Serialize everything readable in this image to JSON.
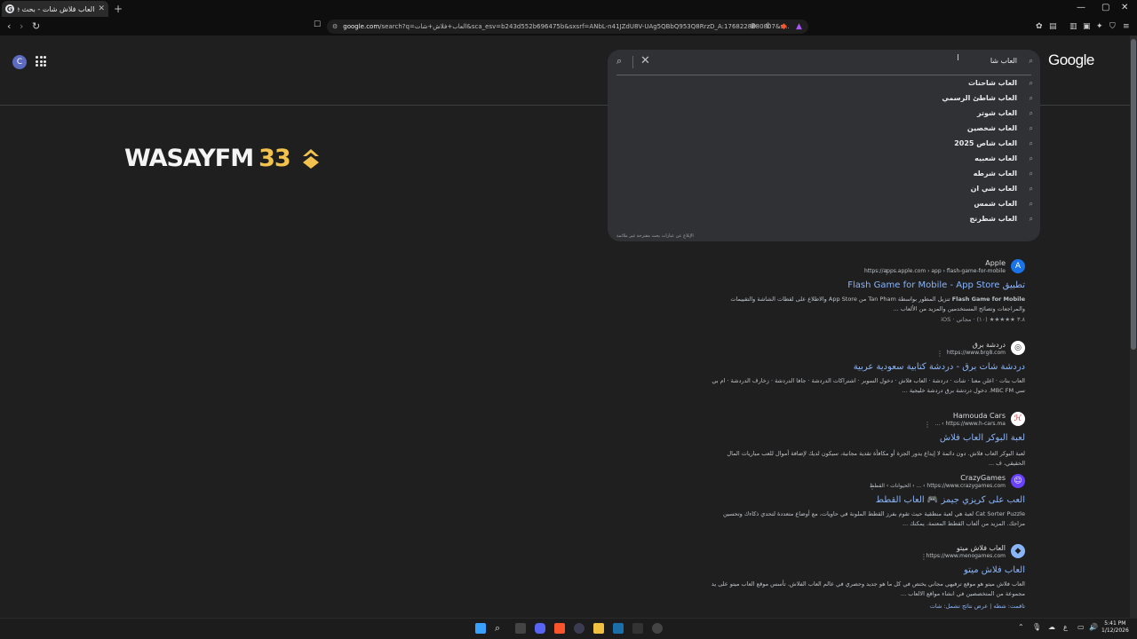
{
  "browser": {
    "tab_title": "العاب فلاش شات - بحث Google",
    "tab_favicon": "G",
    "new_tab": "+",
    "url_domain": "google.com",
    "url_rest": "/search?q=العاب+فلاش+شات&sca_esv=b243d552b696475b&sxsrf=ANbL-n41JZdU8V-UAg5QBbQ953Q8RrzD_A:1768228880807&s...",
    "minimize": "—",
    "maximize": "▢",
    "close": "✕"
  },
  "header": {
    "avatar_letter": "C",
    "logo": "Google"
  },
  "search": {
    "query": "العاب شا",
    "suggestions": [
      "العاب شاحنات",
      "العاب شاطئ الرسمي",
      "العاب شوتر",
      "العاب شخصين",
      "العاب شاص 2025",
      "العاب شعبيه",
      "العاب شرطه",
      "العاب شي ان",
      "العاب شمس",
      "العاب شطرنج"
    ],
    "report_link": "الإبلاغ عن عبارات بحث مقترحة غير ملائمة"
  },
  "banner": {
    "word": "WASAYFM",
    "number": "33"
  },
  "results": [
    {
      "site_name": "Apple",
      "url": "https://apps.apple.com › app › flash-game-for-mobile",
      "title": "تطبيق Flash Game for Mobile - App Store",
      "snippet": "تنزيل المطور بواسطة Tan Pham من App Store والاطلاع على لقطات الشاشة والتقييمات والمراجعات وتصائح المستخدمين والمزيد من الألعاب ...",
      "snippet_bold": "Flash Game for Mobile",
      "meta": "٣.٨ ★★★★★ (١٠) · مجاني · iOS"
    },
    {
      "site_name": "دردشة برق",
      "url": "https://www.brg8.com",
      "title": "دردشة شات برق - دردشة كتابية سعودية عربية",
      "snippet": "العاب بنات · اعلن معنا · شات · دردشة · العاب فلاش · دخول السوبر · اشتراكات الدردشة · جافا الدردشة · زخارف الدردشة · ام بي سي MBC FM. دخول دردشة برق دردشة خليجية ..."
    },
    {
      "site_name": "Hamouda Cars",
      "url": "https://www.h-cars.ma › ...",
      "title": "لعبة البوكر العاب فلاش",
      "snippet": "لعبة البوكر العاب فلاش. دون دائمة لا إيداع يدور الجزة أو مكافأة تقدية مجانية، سيكون لديك لإضافة أموال للعب مباريات المال الحقيقي، ف ..."
    },
    {
      "site_name": "CrazyGames",
      "url": "https://www.crazygames.com › ... › الحيوانات › القطط",
      "title": "العب على كريزي جيمز 🎮 العاب القطط",
      "snippet": "Cat Sorter Puzzle لعبة هي لعبة منطقية حيث تقوم بفرز القطط الملونة في حاويات، مع أوضاع متعددة لتحدي ذكاءك وتحسين مزاجك. المزيد من ألعاب القطط المعتمة. يمكنك ..."
    },
    {
      "site_name": "العاب فلاش ميتو",
      "url": "https://www.menogames.com",
      "title": "العاب فلاش ميتو",
      "snippet": "العاب فلاش ميتو هو موقع ترفيهي مجاني يختص في كل ما هو جديد وحصري في عالم العاب الفلاش. تأسس موقع العاب ميتو على يد مجموعة من المتخصصين في انشاء مواقع الالعاب ...",
      "meta": "تاقمت: شطه | عرض نتائج تشمل: شات"
    }
  ],
  "taskbar": {
    "clock_time": "5:41 PM",
    "clock_date": "1/12/2026",
    "lang": "ع"
  },
  "colors": {
    "accent_link": "#8ab4f8",
    "banner_gold": "#f2c14e",
    "background": "#1f1f1f"
  }
}
